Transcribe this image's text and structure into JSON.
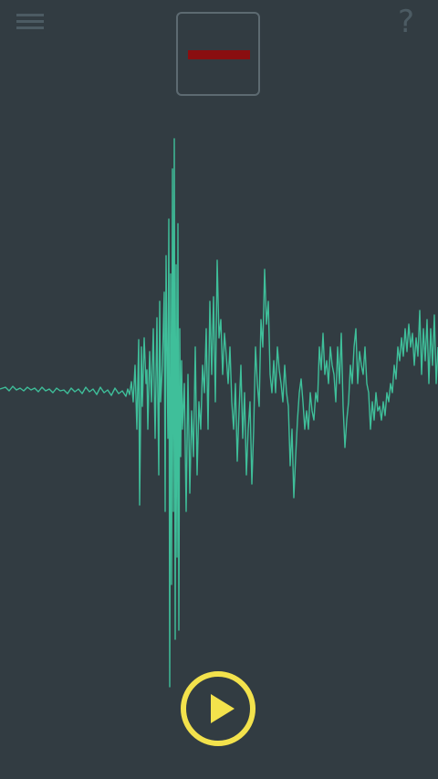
{
  "app": {
    "help_label": "?"
  },
  "icons": {
    "menu": "hamburger-menu-icon",
    "play": "play-icon"
  },
  "colors": {
    "background": "#323c42",
    "waveform": "#3fbf9a",
    "indicator_bar": "#8a0e10",
    "play_accent": "#f3e24c",
    "muted_icon": "#4c5b63"
  }
}
